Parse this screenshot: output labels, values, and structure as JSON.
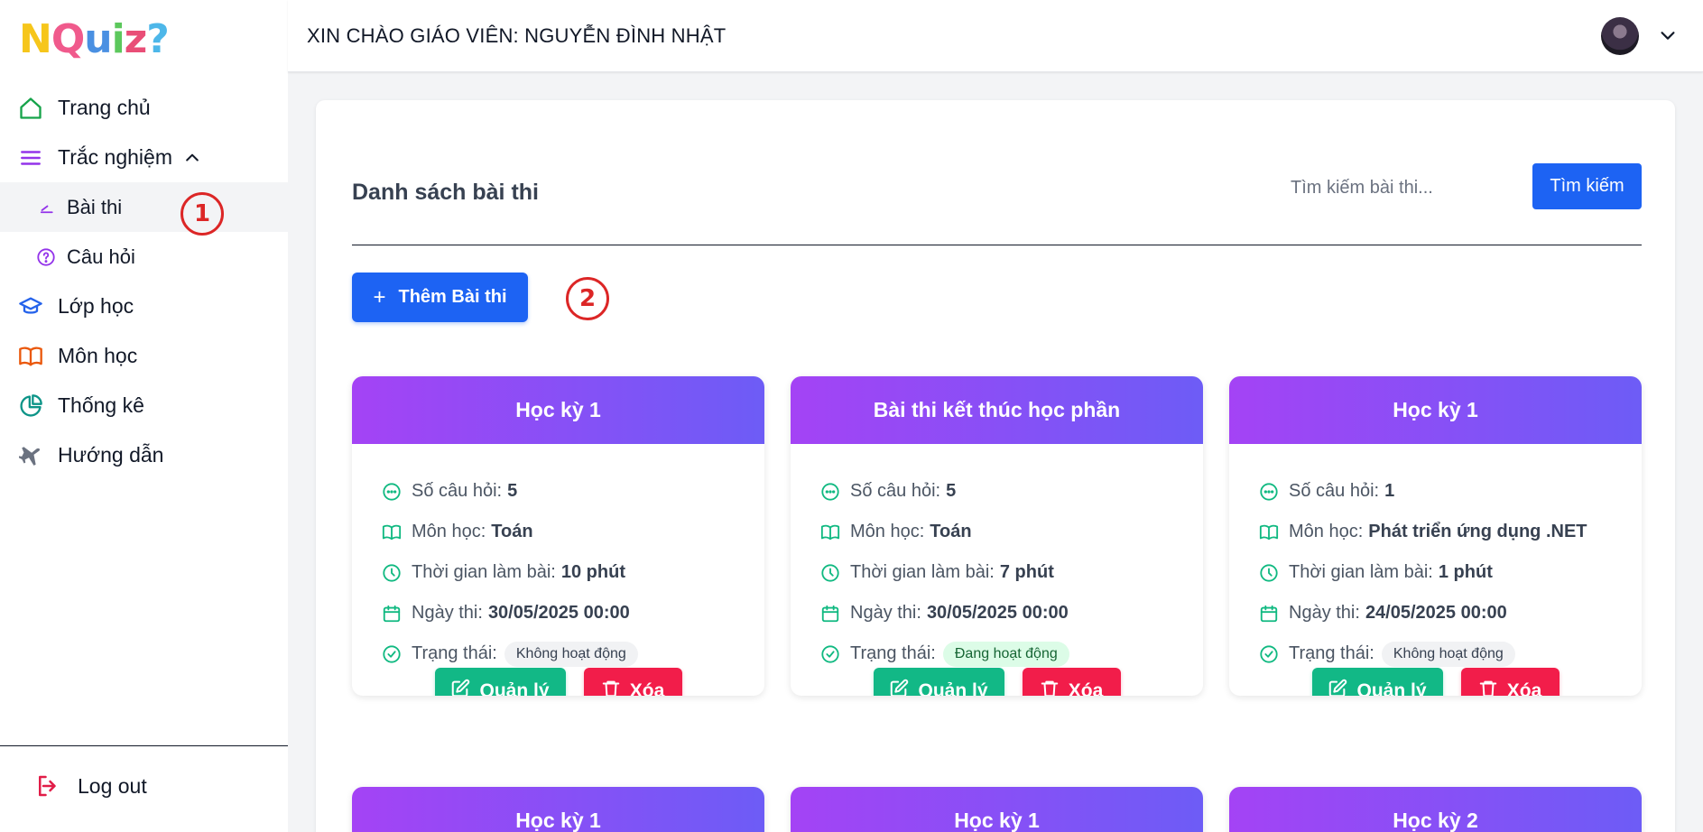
{
  "sidebar": {
    "logo_letters": [
      "N",
      "Q",
      "u",
      "i",
      "z",
      "?"
    ],
    "logo_colors": [
      "#f6c61b",
      "#f05a8c",
      "#4a90e2",
      "#5cc85c",
      "#e94e77",
      "#4db7e9"
    ],
    "items": [
      {
        "label": "Trang chủ",
        "icon": "home-icon"
      },
      {
        "label": "Trắc nghiệm",
        "icon": "menu-lines-icon",
        "expanded": true
      },
      {
        "label": "Bài thi",
        "icon": "pencil-icon",
        "active": true
      },
      {
        "label": "Câu hỏi",
        "icon": "question-circle-icon"
      },
      {
        "label": "Lớp học",
        "icon": "graduation-cap-icon"
      },
      {
        "label": "Môn học",
        "icon": "book-icon"
      },
      {
        "label": "Thống kê",
        "icon": "pie-chart-icon"
      },
      {
        "label": "Hướng dẫn",
        "icon": "plane-icon"
      }
    ],
    "logout_label": "Log out"
  },
  "annotations": {
    "one": "1",
    "two": "2"
  },
  "header": {
    "greeting": "XIN CHÀO GIÁO VIÊN: NGUYỄN ĐÌNH NHẬT"
  },
  "main": {
    "title": "Danh sách bài thi",
    "search_placeholder": "Tìm kiếm bài thi...",
    "search_button": "Tìm kiếm",
    "add_button": "Thêm Bài thi"
  },
  "labels": {
    "questions": "Số câu hỏi:",
    "subject": "Môn học:",
    "duration": "Thời gian làm bài:",
    "date": "Ngày thi:",
    "status": "Trạng thái:",
    "manage": "Quản lý",
    "delete": "Xóa"
  },
  "cards": [
    {
      "title": "Học kỳ 1",
      "questions": "5",
      "subject": "Toán",
      "duration": "10 phút",
      "date": "30/05/2025 00:00",
      "status": "Không hoạt động",
      "active": false
    },
    {
      "title": "Bài thi kết thúc học phần",
      "questions": "5",
      "subject": "Toán",
      "duration": "7 phút",
      "date": "30/05/2025 00:00",
      "status": "Đang hoạt động",
      "active": true
    },
    {
      "title": "Học kỳ 1",
      "questions": "1",
      "subject": "Phát triển ứng dụng .NET",
      "duration": "1 phút",
      "date": "24/05/2025 00:00",
      "status": "Không hoạt động",
      "active": false
    },
    {
      "title": "Học kỳ 1"
    },
    {
      "title": "Học kỳ 1"
    },
    {
      "title": "Học kỳ 2"
    }
  ],
  "colors": {
    "primary": "#1d63f3",
    "manage": "#12b886",
    "delete": "#f21d4a",
    "card_gradient_start": "#a443f5",
    "card_gradient_end": "#6d5cf6"
  }
}
